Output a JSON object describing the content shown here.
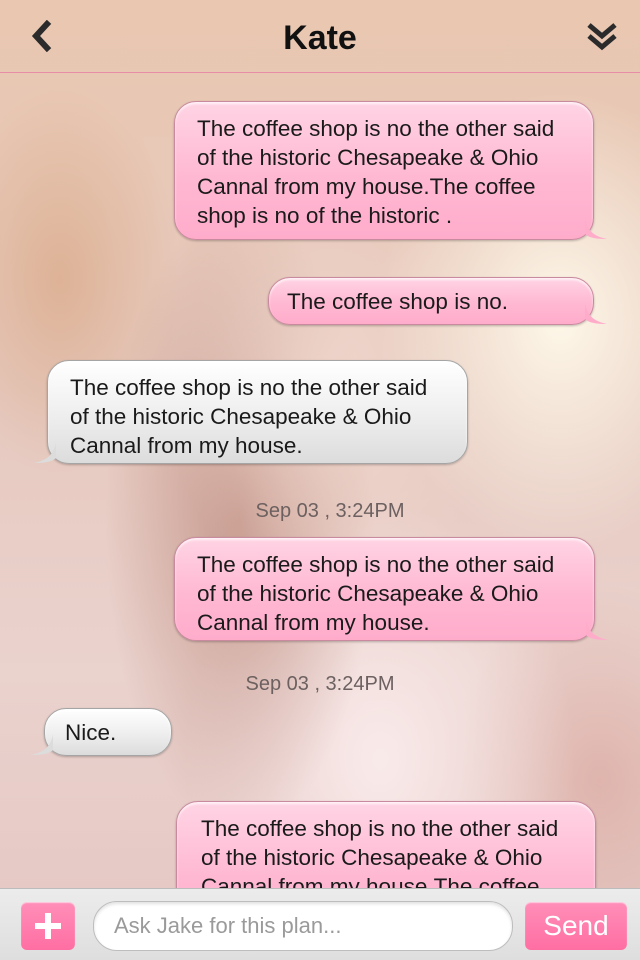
{
  "header": {
    "title": "Kate",
    "back_icon": "chevron-left-icon",
    "collapse_icon": "double-chevron-down-icon"
  },
  "thread": {
    "messages": [
      {
        "direction": "out",
        "text": "The coffee shop is no the other said of the historic Chesapeake & Ohio Cannal from my house.The coffee shop is no of the historic ."
      },
      {
        "direction": "out",
        "text": "The coffee shop is no."
      },
      {
        "direction": "in",
        "text": "The coffee shop is no the other said of the historic Chesapeake & Ohio Cannal from my house."
      },
      {
        "direction": "out",
        "text": "The coffee shop is no the other said of the historic Chesapeake & Ohio Cannal from my house."
      },
      {
        "direction": "in",
        "text": "Nice."
      },
      {
        "direction": "out",
        "text": "The coffee shop is no the other said of the historic Chesapeake & Ohio Cannal from my house.The coffee"
      }
    ],
    "timestamps": [
      "Sep 03 , 3:24PM",
      "Sep 03 , 3:24PM"
    ]
  },
  "composer": {
    "add_icon": "plus-icon",
    "placeholder": "Ask Jake for this plan...",
    "value": "",
    "send_label": "Send"
  },
  "colors": {
    "outgoing_bubble": "#ffb8d2",
    "incoming_bubble": "#ececec",
    "accent": "#ff6ea2",
    "header_rule": "#e98ca8"
  }
}
